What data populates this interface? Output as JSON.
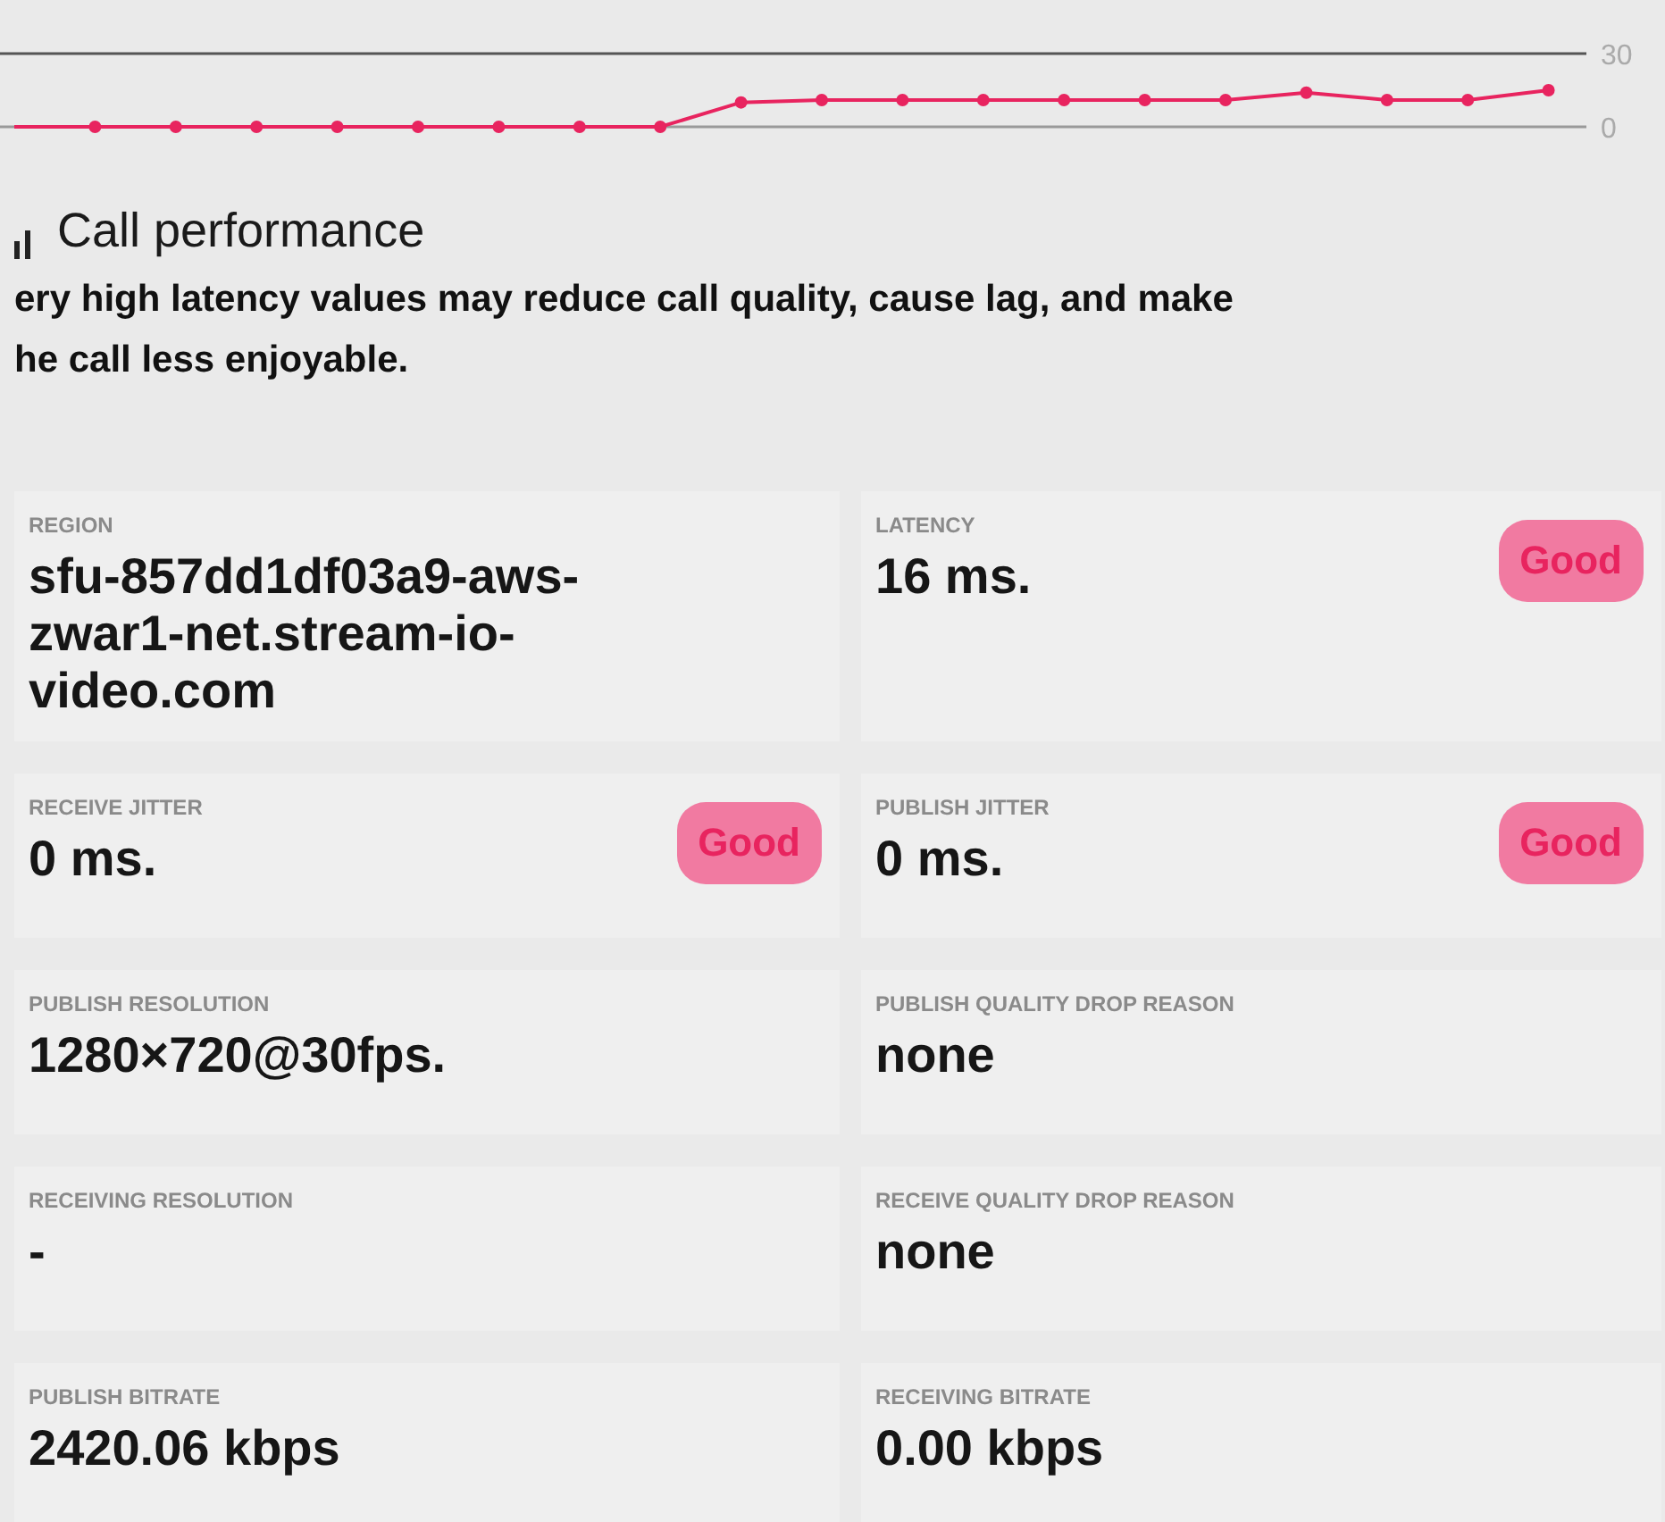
{
  "chart_data": {
    "type": "line",
    "ylim": [
      0,
      30
    ],
    "yticks": [
      0,
      30
    ],
    "series": [
      {
        "color": "#e8245f",
        "marker": "circle",
        "values": [
          0,
          0,
          0,
          0,
          0,
          0,
          0,
          0,
          0,
          10,
          11,
          11,
          11,
          11,
          11,
          11,
          14,
          11,
          11,
          15
        ]
      }
    ]
  },
  "section": {
    "title": "Call performance",
    "description_lines": [
      "ery high latency values may reduce call quality, cause lag, and make",
      "he call less enjoyable."
    ]
  },
  "stats": [
    {
      "label": "REGION",
      "value": "sfu-857dd1df03a9-aws-zwar1-net.stream-io-video.com"
    },
    {
      "label": "LATENCY",
      "value": "16 ms.",
      "badge": "Good"
    },
    {
      "label": "RECEIVE JITTER",
      "value": "0 ms.",
      "badge": "Good"
    },
    {
      "label": "PUBLISH JITTER",
      "value": "0 ms.",
      "badge": "Good"
    },
    {
      "label": "PUBLISH RESOLUTION",
      "value": "1280×720@30fps."
    },
    {
      "label": "PUBLISH QUALITY DROP REASON",
      "value": "none"
    },
    {
      "label": "RECEIVING RESOLUTION",
      "value": "-"
    },
    {
      "label": "RECEIVE QUALITY DROP REASON",
      "value": "none"
    },
    {
      "label": "PUBLISH BITRATE",
      "value": "2420.06 kbps"
    },
    {
      "label": "RECEIVING BITRATE",
      "value": "0.00 kbps"
    }
  ]
}
